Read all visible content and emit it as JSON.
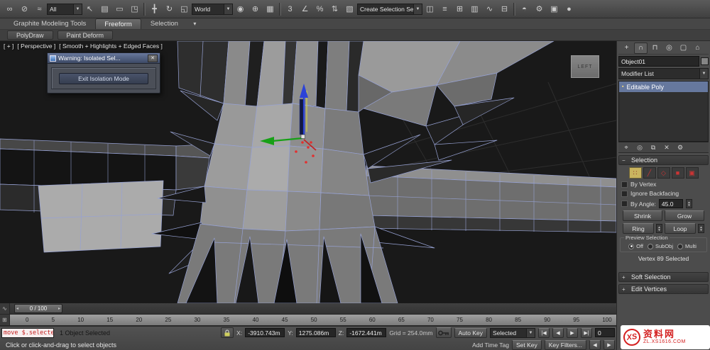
{
  "main_toolbar": {
    "selection_filter_value": "All",
    "coord_system_value": "World",
    "named_selection_value": "Create Selection Se",
    "dropdown_arrow": "▼",
    "icons": {
      "select_and_link": "∞",
      "unlink_selection": "⊘",
      "bind_to_space_warp": "≈",
      "select_object": "↖",
      "select_by_name": "▤",
      "rectangular_selection_region": "▭",
      "window_crossing_toggle": "◳",
      "select_and_move": "╋",
      "select_and_rotate": "↻",
      "select_and_scale": "◱",
      "use_pivot_point_center": "◉",
      "select_and_manipulate": "⊕",
      "keyboard_shortcut_override": "▦",
      "snaps_toggle": "3",
      "angle_snap_toggle": "∠",
      "percent_snap_toggle": "%",
      "spinner_snap_toggle": "⇅",
      "edit_named_selection_sets": "▧",
      "mirror": "◫",
      "align": "≡",
      "layer_manager": "⊞",
      "graphite_ribbon_toggle": "▥",
      "curve_editor": "∿",
      "schematic_view": "⊟",
      "material_editor": "◓",
      "render_setup": "⚙",
      "rendered_frame_window": "▣",
      "render_production": "●"
    }
  },
  "ribbon": {
    "tabs": [
      "Graphite Modeling Tools",
      "Freeform",
      "Selection"
    ],
    "active_tab": "Freeform",
    "subtabs": [
      "PolyDraw",
      "Paint Deform"
    ],
    "collapse_arrow": "▾"
  },
  "viewport": {
    "label_segments": [
      "[ + ]",
      "[ Perspective ]",
      "[ Smooth + Highlights + Edged Faces ]"
    ],
    "viewcube_label": "LEFT"
  },
  "dialog": {
    "title": "Warning: Isolated Sel...",
    "close_glyph": "✕",
    "button_label": "Exit Isolation Mode"
  },
  "command_panel": {
    "tabs": {
      "create": "+",
      "modify": "∩",
      "hierarchy": "⊓",
      "motion": "◎",
      "display": "▢",
      "utilities": "⌂"
    },
    "object_name": "Object01",
    "modifier_list_label": "Modifier List",
    "stack_selected": "Editable Poly",
    "stack_marker": "▪",
    "stack_tools": {
      "pin_stack": "⌖",
      "show_end_result": "◎",
      "make_unique": "⧉",
      "remove_modifier": "✕",
      "configure_modifier_sets": "⚙"
    },
    "selection": {
      "title": "Selection",
      "collapse_glyph": "−",
      "subobject_icons": {
        "vertex": "∷",
        "edge": "╱",
        "border": "◇",
        "polygon": "■",
        "element": "▣"
      },
      "by_vertex_label": "By Vertex",
      "ignore_backfacing_label": "Ignore Backfacing",
      "by_angle_label": "By Angle:",
      "angle_value": "45.0",
      "shrink_label": "Shrink",
      "grow_label": "Grow",
      "ring_label": "Ring",
      "loop_label": "Loop",
      "preview_title": "Preview Selection",
      "preview_options": [
        "Off",
        "SubObj",
        "Multi"
      ],
      "preview_selected": "Off",
      "status_text": "Vertex 89 Selected"
    },
    "soft_selection_title": "Soft Selection",
    "edit_vertices_title": "Edit Vertices",
    "expand_glyph": "+"
  },
  "timeline": {
    "handle_label": "0 / 100",
    "handle_left_arrow": "◂",
    "handle_right_arrow": "▸",
    "mini_curve_editor_glyph": "∿",
    "trackbar_mode_glyph": "⊞",
    "ticks": [
      "0",
      "5",
      "10",
      "15",
      "20",
      "25",
      "30",
      "35",
      "40",
      "45",
      "50",
      "55",
      "60",
      "65",
      "70",
      "75",
      "80",
      "85",
      "90",
      "95",
      "100"
    ]
  },
  "status_bar": {
    "listener_text": "move $.selecte",
    "selection_status": "1 Object Selected",
    "prompt": "Click or click-and-drag to select objects",
    "x_label": "X:",
    "x_value": "-3910.743m",
    "y_label": "Y:",
    "y_value": "1275.086m",
    "z_label": "Z:",
    "z_value": "-1672.441m",
    "grid_text": "Grid = 254.0mm",
    "auto_key_label": "Auto Key",
    "selected_filter_value": "Selected",
    "set_key_label": "Set Key",
    "key_filters_label": "Key Filters...",
    "add_time_tag_label": "Add Time Tag",
    "frame_value": "0",
    "playback": {
      "go_start": "|◀",
      "prev": "◀",
      "play": "▶",
      "next": "▶|"
    },
    "nav": {
      "left": "◀",
      "right": "▶"
    }
  },
  "watermark": {
    "logo_text": "XS",
    "site_name": "资料网",
    "site_url": "ZL.XS1616.COM"
  },
  "colors": {
    "stack_highlight": "#66789e",
    "active_subobject_bg": "#c9b45f",
    "wireframe": "#97a2d4",
    "selected_vertex": "#e23030"
  }
}
